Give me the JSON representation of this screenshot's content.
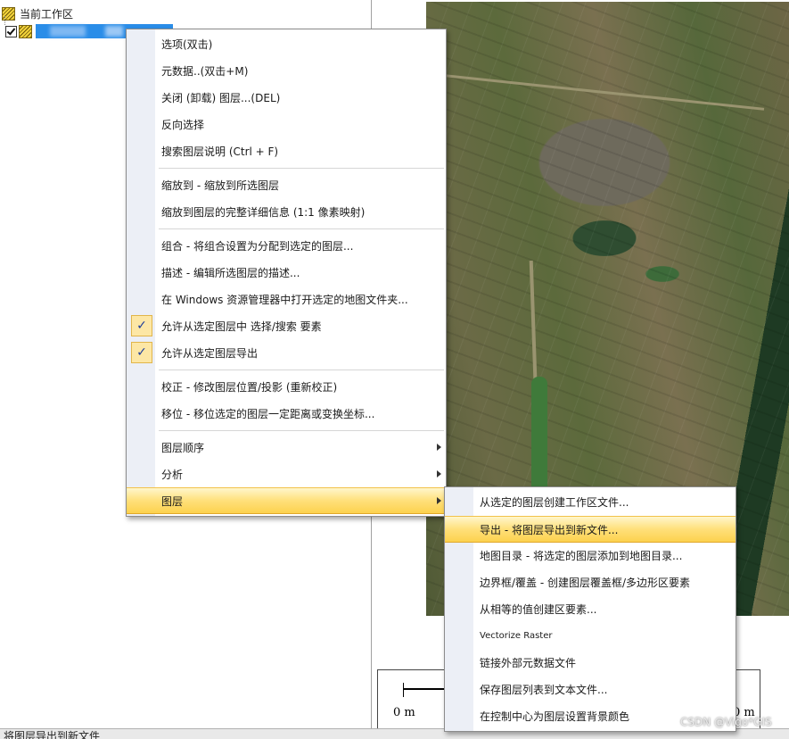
{
  "tree": {
    "workspace_label": "当前工作区",
    "selected_layer_label": ""
  },
  "context_menu": {
    "items": [
      {
        "label": "选项(双击)"
      },
      {
        "label": "元数据..(双击+M)"
      },
      {
        "label": "关闭 (卸载) 图层...(DEL)"
      },
      {
        "label": "反向选择"
      },
      {
        "label": "搜索图层说明 (Ctrl + F)"
      },
      {
        "label": "缩放到 - 缩放到所选图层"
      },
      {
        "label": "缩放到图层的完整详细信息 (1:1 像素映射)"
      },
      {
        "label": "组合 - 将组合设置为分配到选定的图层..."
      },
      {
        "label": "描述 - 编辑所选图层的描述..."
      },
      {
        "label": "在 Windows 资源管理器中打开选定的地图文件夹..."
      },
      {
        "label": "允许从选定图层中 选择/搜索 要素",
        "checked": true
      },
      {
        "label": "允许从选定图层导出",
        "checked": true
      },
      {
        "label": "校正 - 修改图层位置/投影 (重新校正)"
      },
      {
        "label": "移位 - 移位选定的图层一定距离或变换坐标..."
      },
      {
        "label": "图层顺序",
        "submenu": true
      },
      {
        "label": "分析",
        "submenu": true
      },
      {
        "label": "图层",
        "submenu": true,
        "highlighted": true
      }
    ]
  },
  "submenu": {
    "items": [
      {
        "label": "从选定的图层创建工作区文件..."
      },
      {
        "label": "导出 - 将图层导出到新文件...",
        "highlighted": true
      },
      {
        "label": "地图目录 - 将选定的图层添加到地图目录..."
      },
      {
        "label": "边界框/覆盖 - 创建图层覆盖框/多边形区要素"
      },
      {
        "label": "从相等的值创建区要素..."
      },
      {
        "label": "Vectorize Raster"
      },
      {
        "label": "链接外部元数据文件"
      },
      {
        "label": "保存图层列表到文本文件..."
      },
      {
        "label": "在控制中心为图层设置背景颜色"
      }
    ]
  },
  "scale_bar": {
    "left_label": "0 m",
    "right_label": "0 m"
  },
  "status_bar": {
    "text": "将图层导出到新文件"
  },
  "watermark": {
    "text": "CSDN @Vigo*GIS"
  },
  "colors": {
    "highlight": "#ffe07a",
    "selection": "#2a8de8",
    "check_bg": "#fde7a5"
  }
}
